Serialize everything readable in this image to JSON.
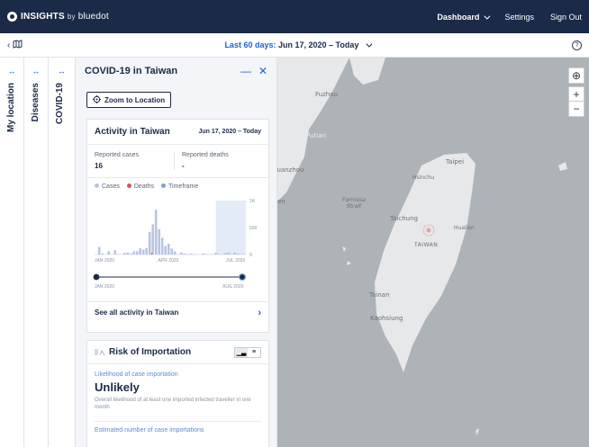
{
  "topbar": {
    "brand": "INSIGHTS",
    "brand_by": "by",
    "brand_company": "bluedot",
    "dashboard": "Dashboard",
    "settings": "Settings",
    "sign_out": "Sign Out"
  },
  "subbar": {
    "range_label": "Last 60 days:",
    "range_value": "Jun 17, 2020 – Today",
    "help": "?"
  },
  "rails": {
    "my_location": "My location",
    "diseases": "Diseases",
    "covid": "COVID-19",
    "arrow": "↔"
  },
  "panel": {
    "title": "COVID-19 in Taiwan",
    "minimize": "—",
    "close": "✕",
    "zoom_button": "Zoom to Location",
    "activity": {
      "title": "Activity in Taiwan",
      "date_range": "Jun 17, 2020 – Today",
      "reported_cases_label": "Reported cases",
      "reported_cases_value": "16",
      "reported_deaths_label": "Reported deaths",
      "reported_deaths_value": "-",
      "legend_cases": "Cases",
      "legend_deaths": "Deaths",
      "legend_timeframe": "Timeframe",
      "see_all": "See all activity in Taiwan",
      "slider_start": "JAN 2020",
      "slider_end": "AUG 2020"
    },
    "risk": {
      "title": "Risk of Importation",
      "likelihood_label": "Likelihood of case importation",
      "likelihood_value": "Unlikely",
      "description": "Overall likelihood of at least one imported infected traveller in one month",
      "estimated_label": "Estimated number of case importations"
    }
  },
  "chart_data": {
    "type": "bar",
    "x_tick_labels": [
      "JAN 2020",
      "APR 2020",
      "JUL 2020"
    ],
    "y_tick_labels": [
      "1K",
      "500",
      "0"
    ],
    "ylim": [
      0,
      1000
    ],
    "timeframe_shaded": true,
    "series": [
      {
        "name": "Cases",
        "values": [
          0,
          140,
          20,
          0,
          60,
          0,
          80,
          10,
          0,
          30,
          40,
          20,
          60,
          60,
          120,
          90,
          120,
          420,
          560,
          830,
          470,
          310,
          160,
          200,
          110,
          60,
          0,
          40,
          20,
          10,
          15,
          10,
          5,
          0,
          20,
          10,
          5,
          5,
          35,
          10,
          0,
          30,
          40,
          10,
          40,
          20,
          5,
          10
        ]
      }
    ],
    "colors": {
      "cases": "#b8c4e6",
      "deaths": "#d9534f",
      "timeframe": "#e3ebf7"
    }
  },
  "map": {
    "labels": [
      "Fuzhou",
      "Putian",
      "Quanzhou",
      "Formosa Strait",
      "Taipei",
      "Hsinchu",
      "Taichung",
      "TAIWAN",
      "Hualien",
      "Tainan",
      "Kaohsiung"
    ]
  },
  "map_controls": {
    "globe": "⊕",
    "zoom_in": "+",
    "zoom_out": "−"
  },
  "colors": {
    "nav_bg": "#1b2a47",
    "accent": "#1a63d4",
    "map_sea": "#aeb3b8",
    "map_land": "#e6e8ea"
  }
}
